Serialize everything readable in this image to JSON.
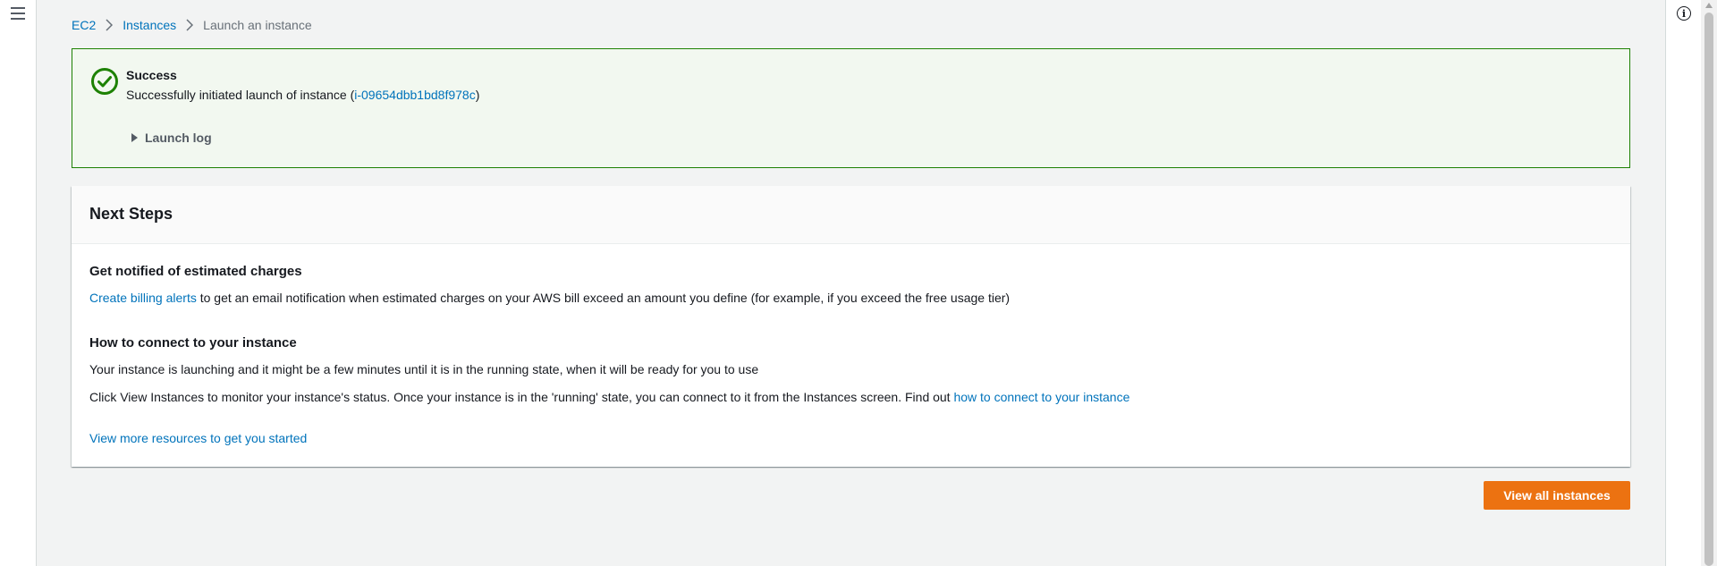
{
  "nav": {
    "menu_icon": "hamburger-menu-icon"
  },
  "breadcrumb": {
    "items": [
      "EC2",
      "Instances"
    ],
    "current": "Launch an instance"
  },
  "flash": {
    "title": "Success",
    "message_prefix": "Successfully initiated launch of instance (",
    "instance_id": "i-09654dbb1bd8f978c",
    "message_suffix": ")",
    "launch_log_label": "Launch log",
    "status_color": "#1d8102"
  },
  "next_steps": {
    "title": "Next Steps",
    "billing": {
      "heading": "Get notified of estimated charges",
      "link": "Create billing alerts",
      "text": " to get an email notification when estimated charges on your AWS bill exceed an amount you define (for example, if you exceed the free usage tier)"
    },
    "connect": {
      "heading": "How to connect to your instance",
      "line1": "Your instance is launching and it might be a few minutes until it is in the running state, when it will be ready for you to use",
      "line2": "Click View Instances to monitor your instance's status. Once your instance is in the 'running' state, you can connect to it from the Instances screen. Find out ",
      "line2_link": "how to connect to your instance"
    },
    "resources_link": "View more resources to get you started"
  },
  "actions": {
    "view_all_label": "View all instances",
    "accent_color": "#ec7211"
  },
  "tools": {
    "info_icon": "info-icon"
  }
}
